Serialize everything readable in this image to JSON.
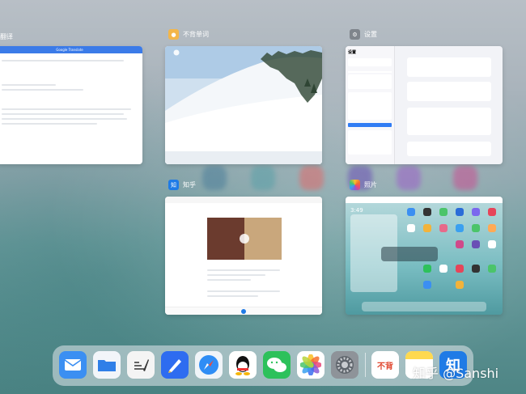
{
  "app_switcher": {
    "cards": [
      {
        "id": "translate",
        "label": "翻译",
        "header": "Google Translate"
      },
      {
        "id": "buzuo",
        "label": "不背单词"
      },
      {
        "id": "settings",
        "label": "设置",
        "sidebar_title": "设置"
      },
      {
        "id": "zhihu",
        "label": "知乎"
      },
      {
        "id": "photos",
        "label": "照片",
        "time": "3:49"
      }
    ]
  },
  "dock": {
    "apps": [
      {
        "name": "mail",
        "color": "#3b8ff2"
      },
      {
        "name": "files",
        "color": "#2f7fe8"
      },
      {
        "name": "notes-sketch",
        "color": "#f4f4f4"
      },
      {
        "name": "pencil-app",
        "color": "#2e6cf0"
      },
      {
        "name": "safari",
        "color": "#2f8df5"
      },
      {
        "name": "qq",
        "color": "#ffffff"
      },
      {
        "name": "wechat",
        "color": "#2dc15b"
      },
      {
        "name": "photos",
        "color": "#ffffff"
      },
      {
        "name": "settings",
        "color": "#8e9399"
      },
      {
        "name": "buzuo",
        "color": "#f7c245",
        "glyph": "不背"
      },
      {
        "name": "notes",
        "color": "#ffd94f"
      },
      {
        "name": "zhihu",
        "color": "#1f7be6",
        "glyph": "知"
      }
    ]
  },
  "watermark": "知乎 @Sanshi"
}
